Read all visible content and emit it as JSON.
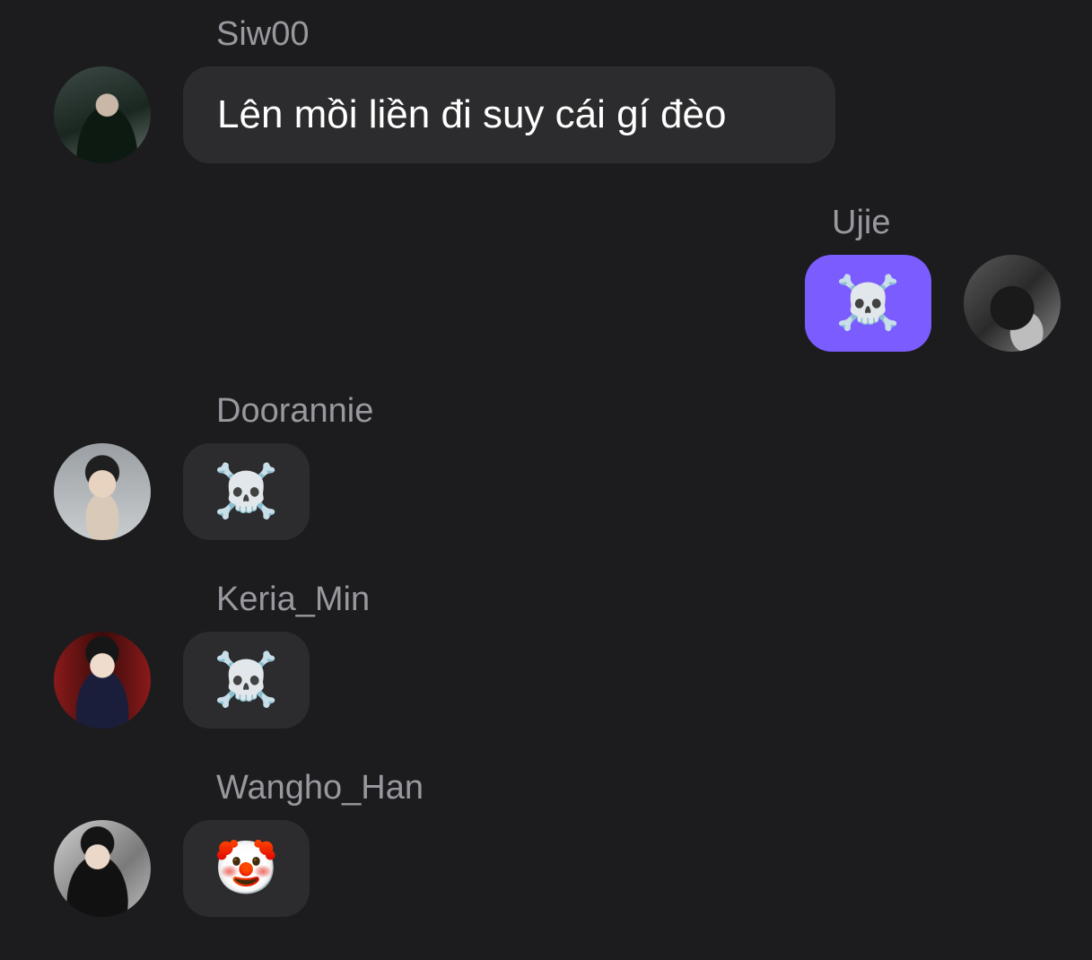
{
  "colors": {
    "background": "#1c1c1e",
    "incoming_bubble": "#2c2c2e",
    "outgoing_bubble": "#7b5cff",
    "sender_text": "#98989f",
    "message_text": "#ffffff"
  },
  "messages": [
    {
      "sender": "Siw00",
      "text": "Lên mồi liền đi suy cái gí đèo",
      "direction": "incoming",
      "avatar": "avatar-siw00"
    },
    {
      "sender": "Ujie",
      "text": "☠️",
      "direction": "outgoing",
      "avatar": "avatar-ujie"
    },
    {
      "sender": "Doorannie",
      "text": "☠️",
      "direction": "incoming",
      "avatar": "avatar-doorannie"
    },
    {
      "sender": "Keria_Min",
      "text": "☠️",
      "direction": "incoming",
      "avatar": "avatar-keria-min"
    },
    {
      "sender": "Wangho_Han",
      "text": "🤡",
      "direction": "incoming",
      "avatar": "avatar-wangho-han"
    }
  ]
}
